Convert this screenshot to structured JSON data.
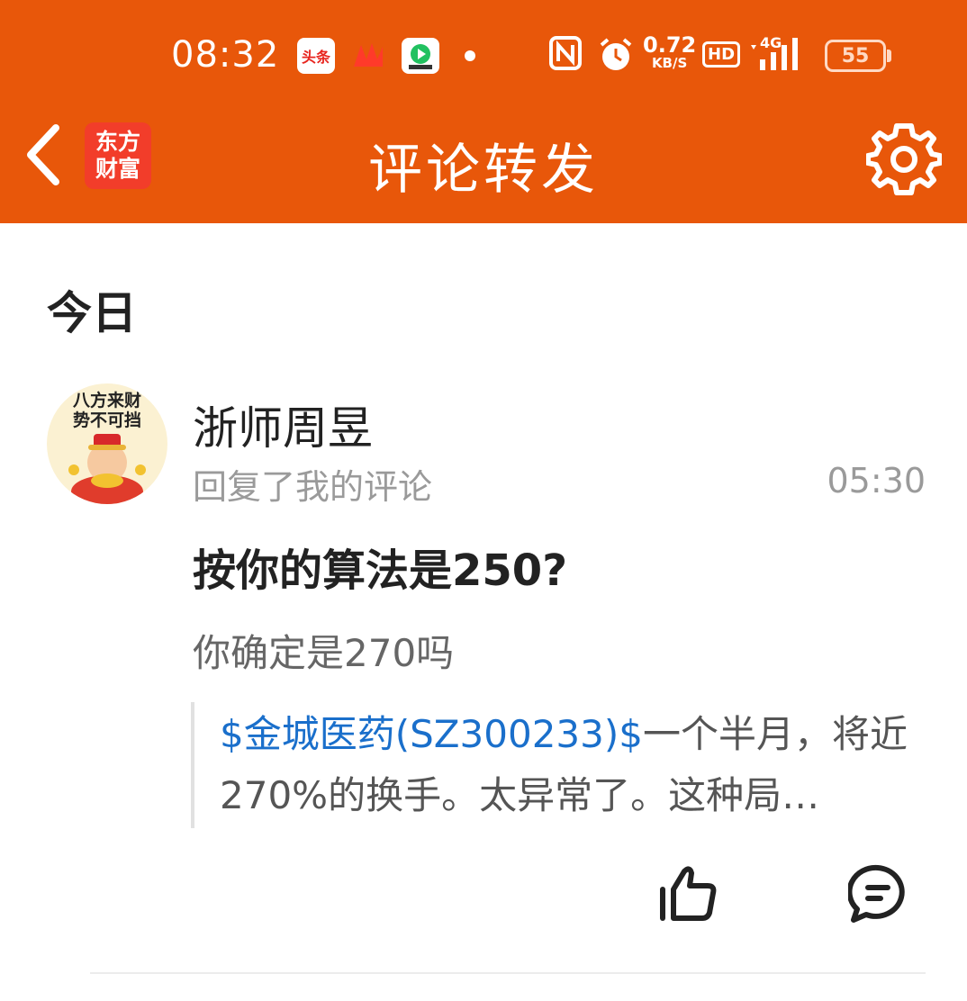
{
  "status_bar": {
    "time": "08:32",
    "apps": [
      "头条",
      "网易",
      "视频"
    ],
    "network_speed_value": "0.72",
    "network_speed_unit": "KB/S",
    "hd_label": "HD",
    "network_type": "4G",
    "battery": "55"
  },
  "nav": {
    "title": "评论转发",
    "logo_line1": "东方",
    "logo_line2": "财富"
  },
  "section": {
    "date_label": "今日"
  },
  "notification": {
    "avatar_text_line1": "八方来财",
    "avatar_text_line2": "势不可挡",
    "username": "浙师周昱",
    "action": "回复了我的评论",
    "time": "05:30",
    "reply": "按你的算法是250?",
    "my_comment": "你确定是270吗",
    "quoted_stock": "$金城医药(SZ300233)$",
    "quoted_text": "一个半月，将近270%的换手。太异常了。这种局…"
  },
  "colors": {
    "header_bg": "#e8570a",
    "link": "#1a6fcb"
  }
}
